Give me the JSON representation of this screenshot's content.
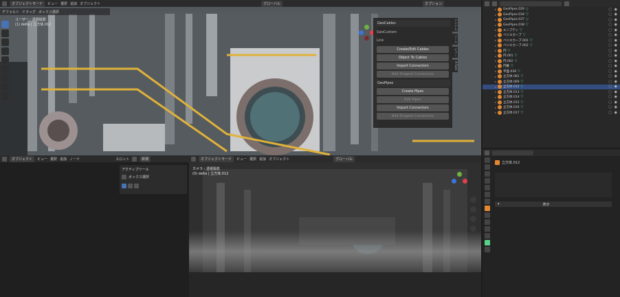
{
  "topbar": {
    "mode": "オブジェクトモード",
    "view": "ビュー",
    "select": "選択",
    "add": "追加",
    "object": "オブジェクト",
    "transform": "グローバル",
    "options": "オプション"
  },
  "viewport_header": {
    "orientation": "デフォルト",
    "drag": "ドラッグ",
    "select_box": "ボックス選択"
  },
  "viewport_info": {
    "line1": "ユーザー・透視投影",
    "line2": "(1) delta | 立方体.012"
  },
  "npanel_tabs": [
    "アイテム",
    "ツール",
    "ビュー",
    "A-Tools"
  ],
  "geocables": {
    "title": "GeoCables",
    "row1": "GeoCustom",
    "row2": "Link",
    "btn_create": "Create/Edit Cables",
    "btn_object": "Object To Cables",
    "btn_import": "Import Connectors",
    "btn_add": "Add Shipped Connectors"
  },
  "geopipes": {
    "title": "GeoPipes",
    "btn_create": "Create Pipes",
    "btn_edit": "Edit Pipes",
    "btn_import": "Import Connectors",
    "btn_add": "Add Shipped Connectors"
  },
  "outliner": {
    "search": "",
    "rows": [
      {
        "label": "GeoPipes.029",
        "sel": false
      },
      {
        "label": "GeoPipes.034",
        "sel": false
      },
      {
        "label": "GeoPipes.037",
        "sel": false
      },
      {
        "label": "GeoPipes.038",
        "sel": false
      },
      {
        "label": "エンプティ",
        "sel": false
      },
      {
        "label": "ベジエカーブ",
        "sel": false
      },
      {
        "label": "ベジエカーブ.001",
        "sel": false
      },
      {
        "label": "ベジエカーブ.002",
        "sel": false
      },
      {
        "label": "円",
        "sel": false
      },
      {
        "label": "円.001",
        "sel": false
      },
      {
        "label": "円.002",
        "sel": false
      },
      {
        "label": "円錐",
        "sel": false
      },
      {
        "label": "平面.039",
        "sel": false
      },
      {
        "label": "立方体.062",
        "sel": false
      },
      {
        "label": "立方体.069",
        "sel": false
      },
      {
        "label": "立方体.012",
        "sel": true
      },
      {
        "label": "立方体.013",
        "sel": false
      },
      {
        "label": "立方体.014",
        "sel": false
      },
      {
        "label": "立方体.015",
        "sel": false
      },
      {
        "label": "立方体.016",
        "sel": false
      },
      {
        "label": "立方体.017",
        "sel": false
      }
    ]
  },
  "properties": {
    "object_name": "立方体.012",
    "section": "表示"
  },
  "anim_header": {
    "mode": "オブジェクト",
    "view": "ビュー",
    "select": "選択",
    "marker": "追加",
    "node": "ノード",
    "slot": "スロット",
    "new": "新規"
  },
  "active_tool": {
    "title": "アクティブツール",
    "tool": "ボックス選択"
  },
  "cam_header": {
    "mode": "オブジェクトモード",
    "view": "ビュー",
    "select": "選択",
    "add": "追加",
    "object": "オブジェクト",
    "transform": "グローバル"
  },
  "cam_info": {
    "line1": "カメラ・透視投影",
    "line2": "(0) delta | 立方体.012"
  },
  "colors": {
    "accent": "#4772b3",
    "selected_row": "#334d80",
    "object_orange": "#e38732",
    "mesh_green": "#59d18b"
  }
}
